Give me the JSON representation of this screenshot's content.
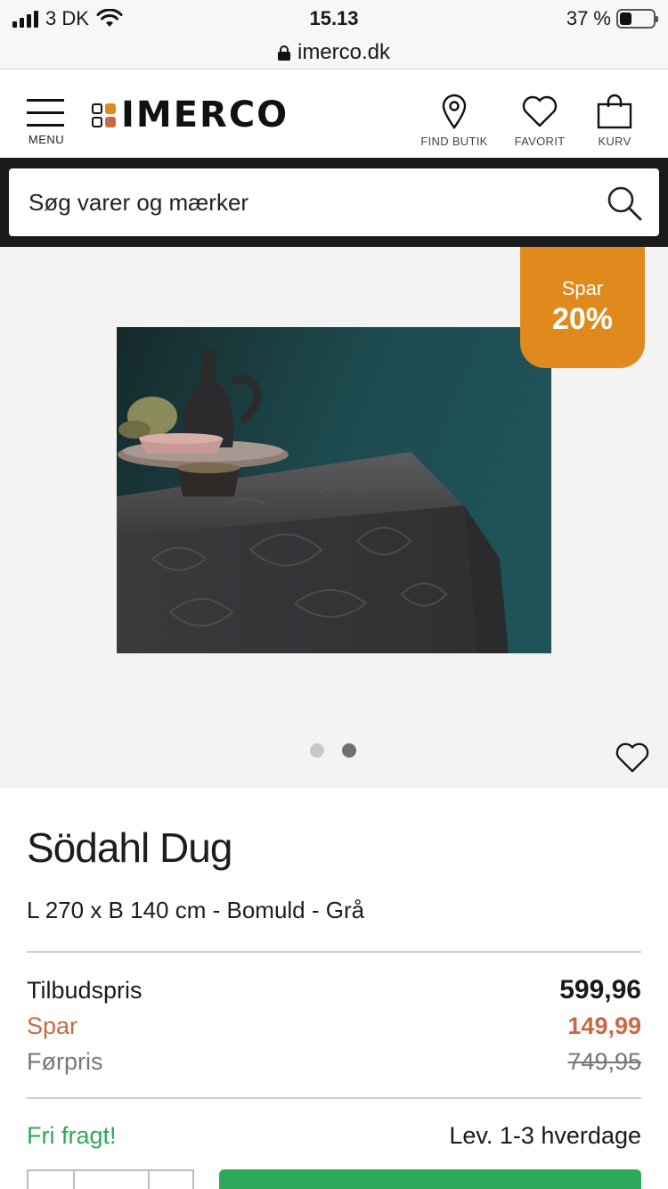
{
  "status_bar": {
    "carrier": "3 DK",
    "time": "15.13",
    "battery_percent": "37 %",
    "battery_level": 0.37
  },
  "browser": {
    "url": "imerco.dk"
  },
  "header": {
    "menu_label": "MENU",
    "logo_text": "IMERCO",
    "actions": [
      {
        "label": "FIND BUTIK",
        "icon": "location-pin-icon"
      },
      {
        "label": "FAVORIT",
        "icon": "heart-icon"
      },
      {
        "label": "KURV",
        "icon": "shopping-bag-icon"
      }
    ]
  },
  "search": {
    "placeholder": "Søg varer og mærker"
  },
  "gallery": {
    "badge_line1": "Spar",
    "badge_line2": "20%",
    "image_count": 2,
    "active_index": 1,
    "image_alt": "Grey floral damask tablecloth with dark ceramics on a teal background"
  },
  "product": {
    "title": "Södahl Dug",
    "subtitle": "L 270 x B 140 cm - Bomuld - Grå",
    "prices": {
      "offer_label": "Tilbudspris",
      "offer_value": "599,96",
      "save_label": "Spar",
      "save_value": "149,99",
      "before_label": "Førpris",
      "before_value": "749,95"
    },
    "shipping": {
      "free_label": "Fri fragt!",
      "delivery": "Lev. 1-3 hverdage"
    }
  },
  "colors": {
    "badge": "#e08a1e",
    "save": "#c96a44",
    "green": "#2ea85a",
    "search_bar": "#1a1a1a"
  }
}
